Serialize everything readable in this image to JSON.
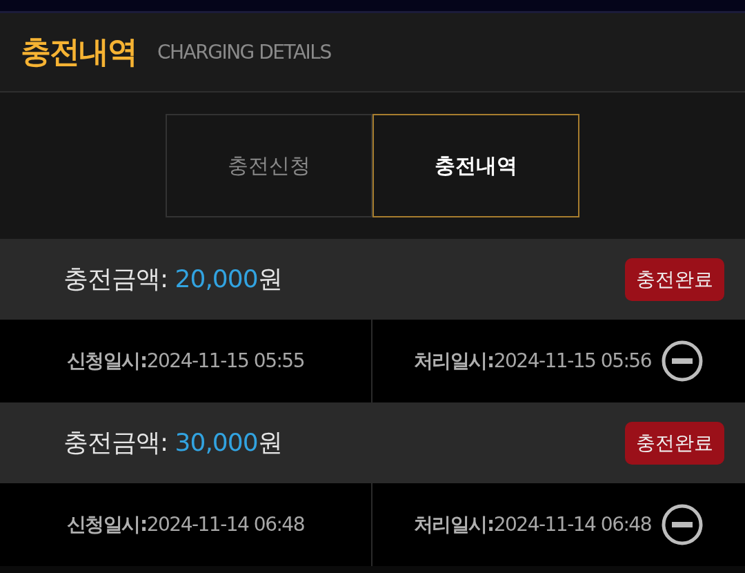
{
  "header": {
    "title": "충전내역",
    "subtitle": "CHARGING DETAILS"
  },
  "tabs": [
    {
      "label": "충전신청",
      "selected": false
    },
    {
      "label": "충전내역",
      "selected": true
    }
  ],
  "records": [
    {
      "amount_label": "충전금액:",
      "amount": "20,000",
      "unit": "원",
      "status": "충전완료",
      "requested_label": "신청일시:",
      "requested": "2024-11-15 05:55",
      "processed_label": "처리일시:",
      "processed": "2024-11-15 05:56"
    },
    {
      "amount_label": "충전금액:",
      "amount": "30,000",
      "unit": "원",
      "status": "충전완료",
      "requested_label": "신청일시:",
      "requested": "2024-11-14 06:48",
      "processed_label": "처리일시:",
      "processed": "2024-11-14 06:48"
    }
  ]
}
